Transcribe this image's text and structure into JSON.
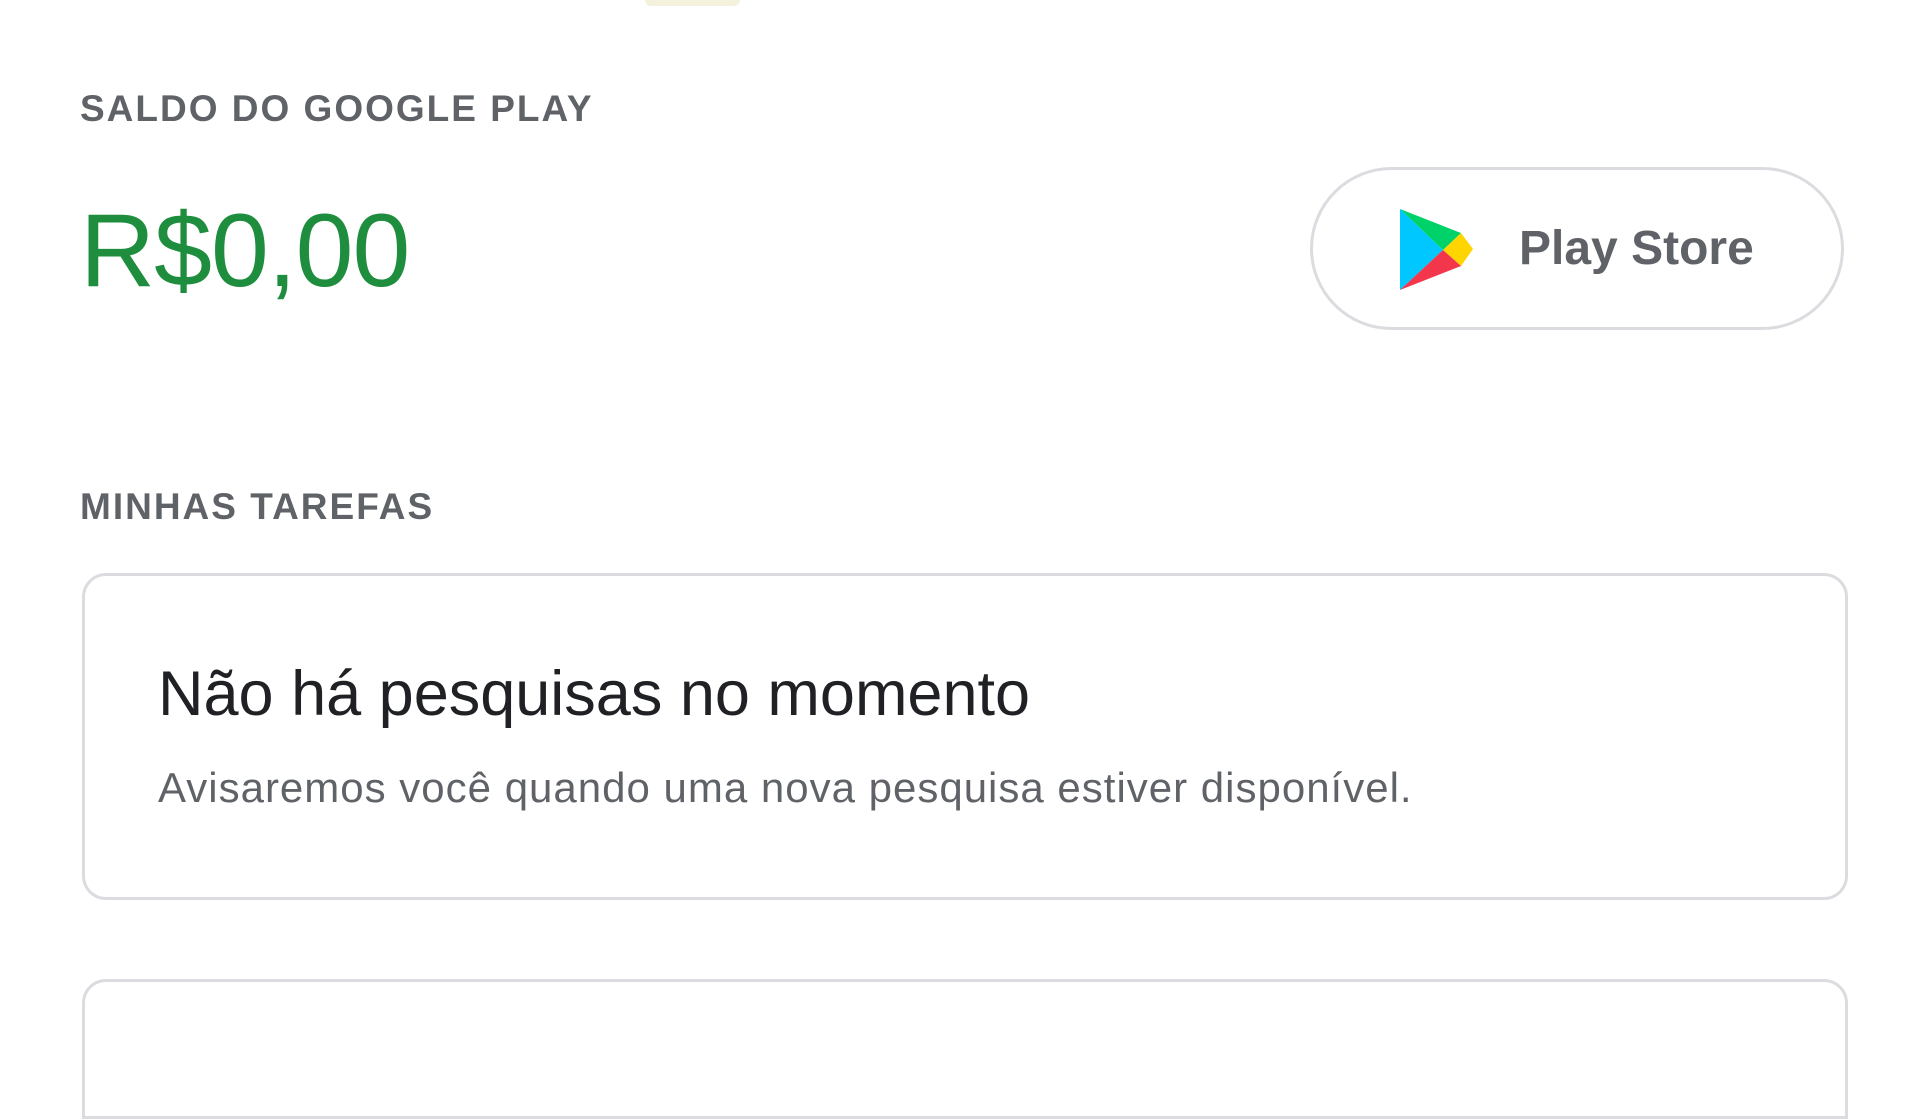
{
  "balance_section": {
    "label": "SALDO DO GOOGLE PLAY",
    "amount": "R$0,00",
    "amount_color": "#1e8e3e"
  },
  "play_store_button": {
    "label": "Play Store",
    "icon": "google-play-icon"
  },
  "tasks_section": {
    "label": "MINHAS TAREFAS",
    "survey_card": {
      "title": "Não há pesquisas no momento",
      "description": "Avisaremos você quando uma nova pesquisa estiver disponível."
    }
  },
  "colors": {
    "label": "#5f6368",
    "border": "#dadce0",
    "balance": "#1e8e3e"
  }
}
